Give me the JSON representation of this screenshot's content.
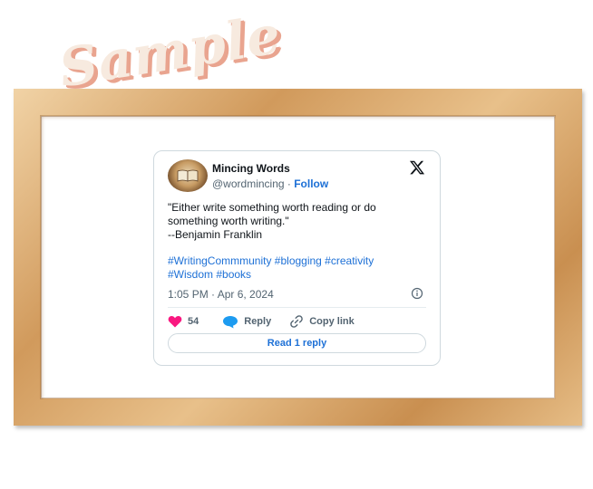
{
  "watermark": "Sample",
  "tweet": {
    "author_name": "Mincing Words",
    "handle": "@wordmincing",
    "separator": " · ",
    "follow_label": "Follow",
    "text_lines": [
      "\"Either write something worth reading or do",
      "something worth writing.\"",
      "--Benjamin Franklin"
    ],
    "hashtag_lines": [
      "#WritingCommmunity #blogging #creativity",
      "#Wisdom #books"
    ],
    "timestamp": "1:05 PM · Apr 6, 2024",
    "likes": "54",
    "reply_label": "Reply",
    "copy_link_label": "Copy link",
    "read_replies_label": "Read 1 reply"
  },
  "colors": {
    "link": "#1d70d6",
    "like": "#f91880",
    "reply": "#1d9bf0",
    "frame": "#d9a86e"
  },
  "icons": [
    "x-logo-icon",
    "info-icon",
    "heart-icon",
    "reply-bubble-icon",
    "link-icon"
  ]
}
